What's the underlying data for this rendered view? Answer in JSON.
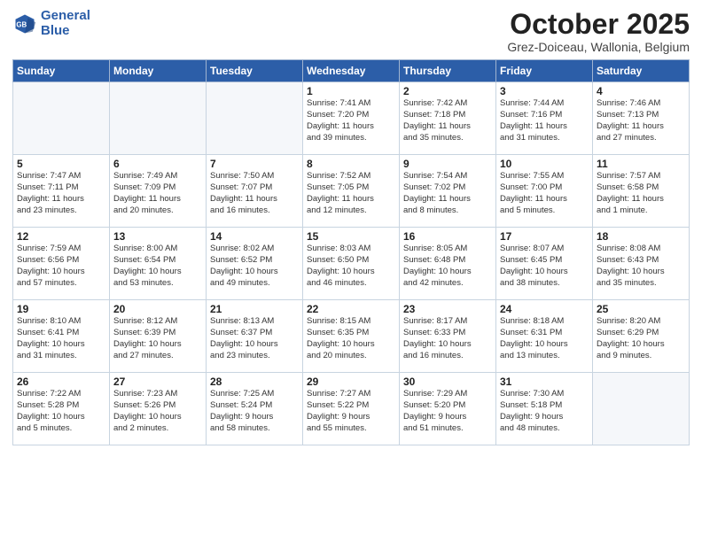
{
  "header": {
    "logo_line1": "General",
    "logo_line2": "Blue",
    "month": "October 2025",
    "location": "Grez-Doiceau, Wallonia, Belgium"
  },
  "days_of_week": [
    "Sunday",
    "Monday",
    "Tuesday",
    "Wednesday",
    "Thursday",
    "Friday",
    "Saturday"
  ],
  "weeks": [
    [
      {
        "day": "",
        "info": ""
      },
      {
        "day": "",
        "info": ""
      },
      {
        "day": "",
        "info": ""
      },
      {
        "day": "1",
        "info": "Sunrise: 7:41 AM\nSunset: 7:20 PM\nDaylight: 11 hours\nand 39 minutes."
      },
      {
        "day": "2",
        "info": "Sunrise: 7:42 AM\nSunset: 7:18 PM\nDaylight: 11 hours\nand 35 minutes."
      },
      {
        "day": "3",
        "info": "Sunrise: 7:44 AM\nSunset: 7:16 PM\nDaylight: 11 hours\nand 31 minutes."
      },
      {
        "day": "4",
        "info": "Sunrise: 7:46 AM\nSunset: 7:13 PM\nDaylight: 11 hours\nand 27 minutes."
      }
    ],
    [
      {
        "day": "5",
        "info": "Sunrise: 7:47 AM\nSunset: 7:11 PM\nDaylight: 11 hours\nand 23 minutes."
      },
      {
        "day": "6",
        "info": "Sunrise: 7:49 AM\nSunset: 7:09 PM\nDaylight: 11 hours\nand 20 minutes."
      },
      {
        "day": "7",
        "info": "Sunrise: 7:50 AM\nSunset: 7:07 PM\nDaylight: 11 hours\nand 16 minutes."
      },
      {
        "day": "8",
        "info": "Sunrise: 7:52 AM\nSunset: 7:05 PM\nDaylight: 11 hours\nand 12 minutes."
      },
      {
        "day": "9",
        "info": "Sunrise: 7:54 AM\nSunset: 7:02 PM\nDaylight: 11 hours\nand 8 minutes."
      },
      {
        "day": "10",
        "info": "Sunrise: 7:55 AM\nSunset: 7:00 PM\nDaylight: 11 hours\nand 5 minutes."
      },
      {
        "day": "11",
        "info": "Sunrise: 7:57 AM\nSunset: 6:58 PM\nDaylight: 11 hours\nand 1 minute."
      }
    ],
    [
      {
        "day": "12",
        "info": "Sunrise: 7:59 AM\nSunset: 6:56 PM\nDaylight: 10 hours\nand 57 minutes."
      },
      {
        "day": "13",
        "info": "Sunrise: 8:00 AM\nSunset: 6:54 PM\nDaylight: 10 hours\nand 53 minutes."
      },
      {
        "day": "14",
        "info": "Sunrise: 8:02 AM\nSunset: 6:52 PM\nDaylight: 10 hours\nand 49 minutes."
      },
      {
        "day": "15",
        "info": "Sunrise: 8:03 AM\nSunset: 6:50 PM\nDaylight: 10 hours\nand 46 minutes."
      },
      {
        "day": "16",
        "info": "Sunrise: 8:05 AM\nSunset: 6:48 PM\nDaylight: 10 hours\nand 42 minutes."
      },
      {
        "day": "17",
        "info": "Sunrise: 8:07 AM\nSunset: 6:45 PM\nDaylight: 10 hours\nand 38 minutes."
      },
      {
        "day": "18",
        "info": "Sunrise: 8:08 AM\nSunset: 6:43 PM\nDaylight: 10 hours\nand 35 minutes."
      }
    ],
    [
      {
        "day": "19",
        "info": "Sunrise: 8:10 AM\nSunset: 6:41 PM\nDaylight: 10 hours\nand 31 minutes."
      },
      {
        "day": "20",
        "info": "Sunrise: 8:12 AM\nSunset: 6:39 PM\nDaylight: 10 hours\nand 27 minutes."
      },
      {
        "day": "21",
        "info": "Sunrise: 8:13 AM\nSunset: 6:37 PM\nDaylight: 10 hours\nand 23 minutes."
      },
      {
        "day": "22",
        "info": "Sunrise: 8:15 AM\nSunset: 6:35 PM\nDaylight: 10 hours\nand 20 minutes."
      },
      {
        "day": "23",
        "info": "Sunrise: 8:17 AM\nSunset: 6:33 PM\nDaylight: 10 hours\nand 16 minutes."
      },
      {
        "day": "24",
        "info": "Sunrise: 8:18 AM\nSunset: 6:31 PM\nDaylight: 10 hours\nand 13 minutes."
      },
      {
        "day": "25",
        "info": "Sunrise: 8:20 AM\nSunset: 6:29 PM\nDaylight: 10 hours\nand 9 minutes."
      }
    ],
    [
      {
        "day": "26",
        "info": "Sunrise: 7:22 AM\nSunset: 5:28 PM\nDaylight: 10 hours\nand 5 minutes."
      },
      {
        "day": "27",
        "info": "Sunrise: 7:23 AM\nSunset: 5:26 PM\nDaylight: 10 hours\nand 2 minutes."
      },
      {
        "day": "28",
        "info": "Sunrise: 7:25 AM\nSunset: 5:24 PM\nDaylight: 9 hours\nand 58 minutes."
      },
      {
        "day": "29",
        "info": "Sunrise: 7:27 AM\nSunset: 5:22 PM\nDaylight: 9 hours\nand 55 minutes."
      },
      {
        "day": "30",
        "info": "Sunrise: 7:29 AM\nSunset: 5:20 PM\nDaylight: 9 hours\nand 51 minutes."
      },
      {
        "day": "31",
        "info": "Sunrise: 7:30 AM\nSunset: 5:18 PM\nDaylight: 9 hours\nand 48 minutes."
      },
      {
        "day": "",
        "info": ""
      }
    ]
  ]
}
